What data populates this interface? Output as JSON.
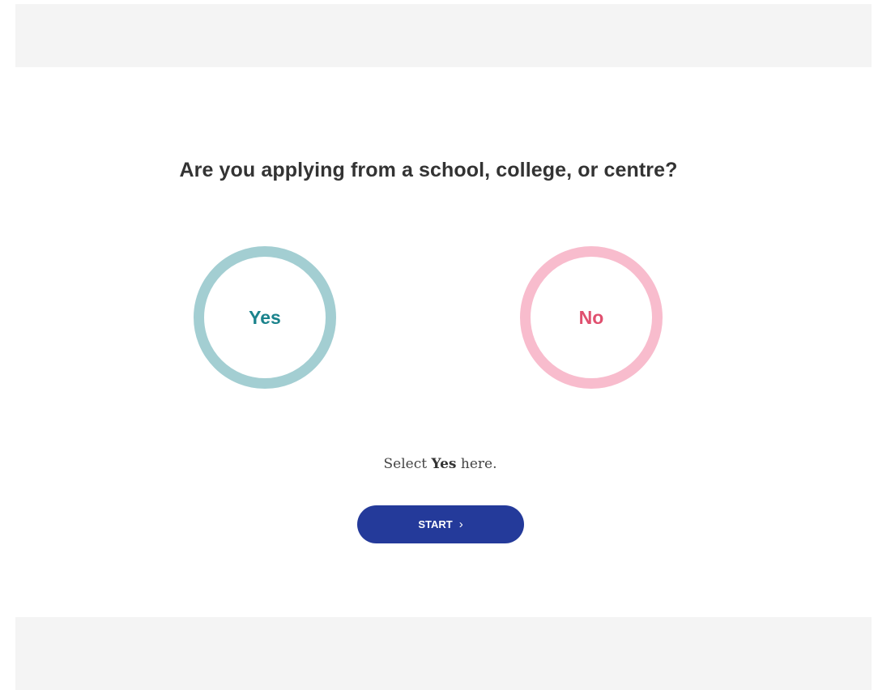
{
  "question": "Are you applying from a school, college, or centre?",
  "choices": {
    "yes": {
      "label": "Yes",
      "ring_color": "#a3ced2",
      "text_color": "#1b838c"
    },
    "no": {
      "label": "No",
      "ring_color": "#f8bccd",
      "text_color": "#e0506f"
    }
  },
  "hint": {
    "before": "Select ",
    "emphasis": "Yes",
    "after": " here."
  },
  "start_button": {
    "label": "START",
    "icon": "chevron-right-icon",
    "icon_glyph": "›",
    "background": "#243a9a"
  }
}
